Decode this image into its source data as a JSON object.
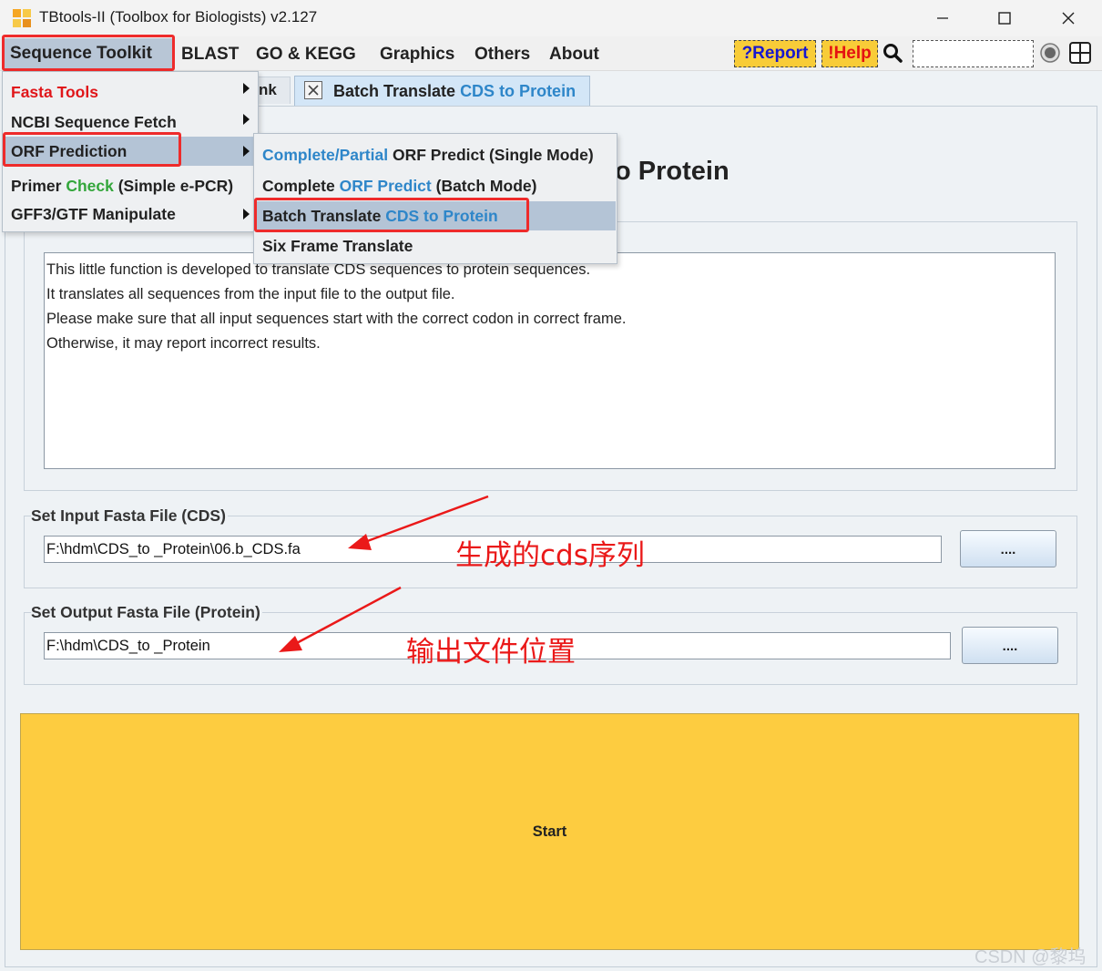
{
  "window": {
    "title": "TBtools-II (Toolbox for Biologists) v2.127"
  },
  "menubar": {
    "items": [
      "Sequence Toolkit",
      "BLAST",
      "GO & KEGG",
      "Graphics",
      "Others",
      "About"
    ],
    "report_label": "?Report",
    "help_label": "!Help",
    "search_value": ""
  },
  "tabs": {
    "partial_label": "nk",
    "active_prefix": "Batch Translate ",
    "active_highlight": "CDS to Protein"
  },
  "main": {
    "title": "o Protein",
    "description": [
      "This little function is developed to translate CDS sequences to protein sequences.",
      "It translates all sequences from the input file to the output file.",
      "Please make sure that all input sequences start with the correct codon in correct frame.",
      "Otherwise, it may report incorrect results."
    ],
    "input_label": "Set Input Fasta File (CDS)",
    "input_value": "F:\\hdm\\CDS_to _Protein\\06.b_CDS.fa",
    "output_label": "Set Output Fasta File (Protein)",
    "output_value": "F:\\hdm\\CDS_to _Protein",
    "browse_label": "....",
    "start_label": "Start"
  },
  "dropdown": {
    "fasta": "Fasta Tools",
    "ncbi": "NCBI Sequence Fetch",
    "orf": "ORF Prediction",
    "primer_a": "Primer ",
    "primer_b": "Check",
    "primer_c": " (Simple e-PCR)",
    "gff": "GFF3/GTF Manipulate"
  },
  "submenu": {
    "single_a": "Complete/Partial",
    "single_b": " ORF Predict (Single Mode)",
    "batch_a": "Complete ",
    "batch_b": "ORF Predict",
    "batch_c": " (Batch Mode)",
    "translate_a": "Batch Translate ",
    "translate_b": "CDS to Protein",
    "six": "Six Frame Translate"
  },
  "annotations": {
    "cds": "生成的cds序列",
    "output": "输出文件位置",
    "highlight_color": "#ee2b2b"
  },
  "watermark": "CSDN @黎坞"
}
